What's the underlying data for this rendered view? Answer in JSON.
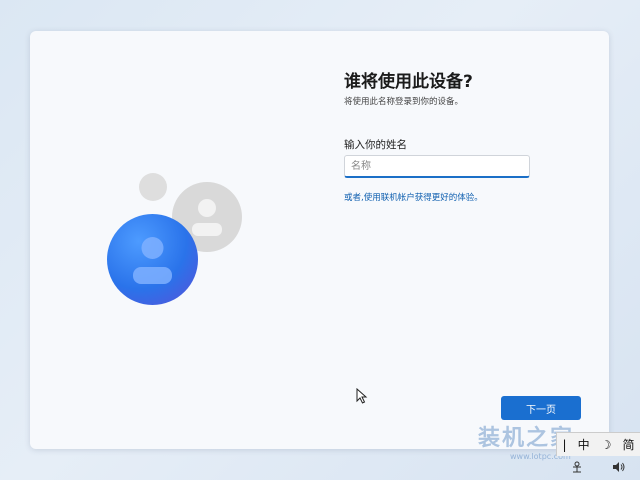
{
  "dialog": {
    "title": "谁将使用此设备?",
    "subtitle": "将使用此名称登录到你的设备。",
    "name_label": "输入你的姓名",
    "name_placeholder": "名称",
    "name_value": "",
    "alt_link": "或者,使用联机帐户获得更好的体验。",
    "next_button": "下一页"
  },
  "watermark": {
    "text": "装机之家",
    "url": "www.lotpc.com"
  },
  "ime": {
    "cursor_mark": "|",
    "mode": "中",
    "moon": "☽",
    "script": "简"
  },
  "tray": {
    "network_icon": "network-icon",
    "volume_icon": "volume-icon"
  },
  "colors": {
    "accent": "#1a6fd0",
    "link": "#1060b0"
  }
}
